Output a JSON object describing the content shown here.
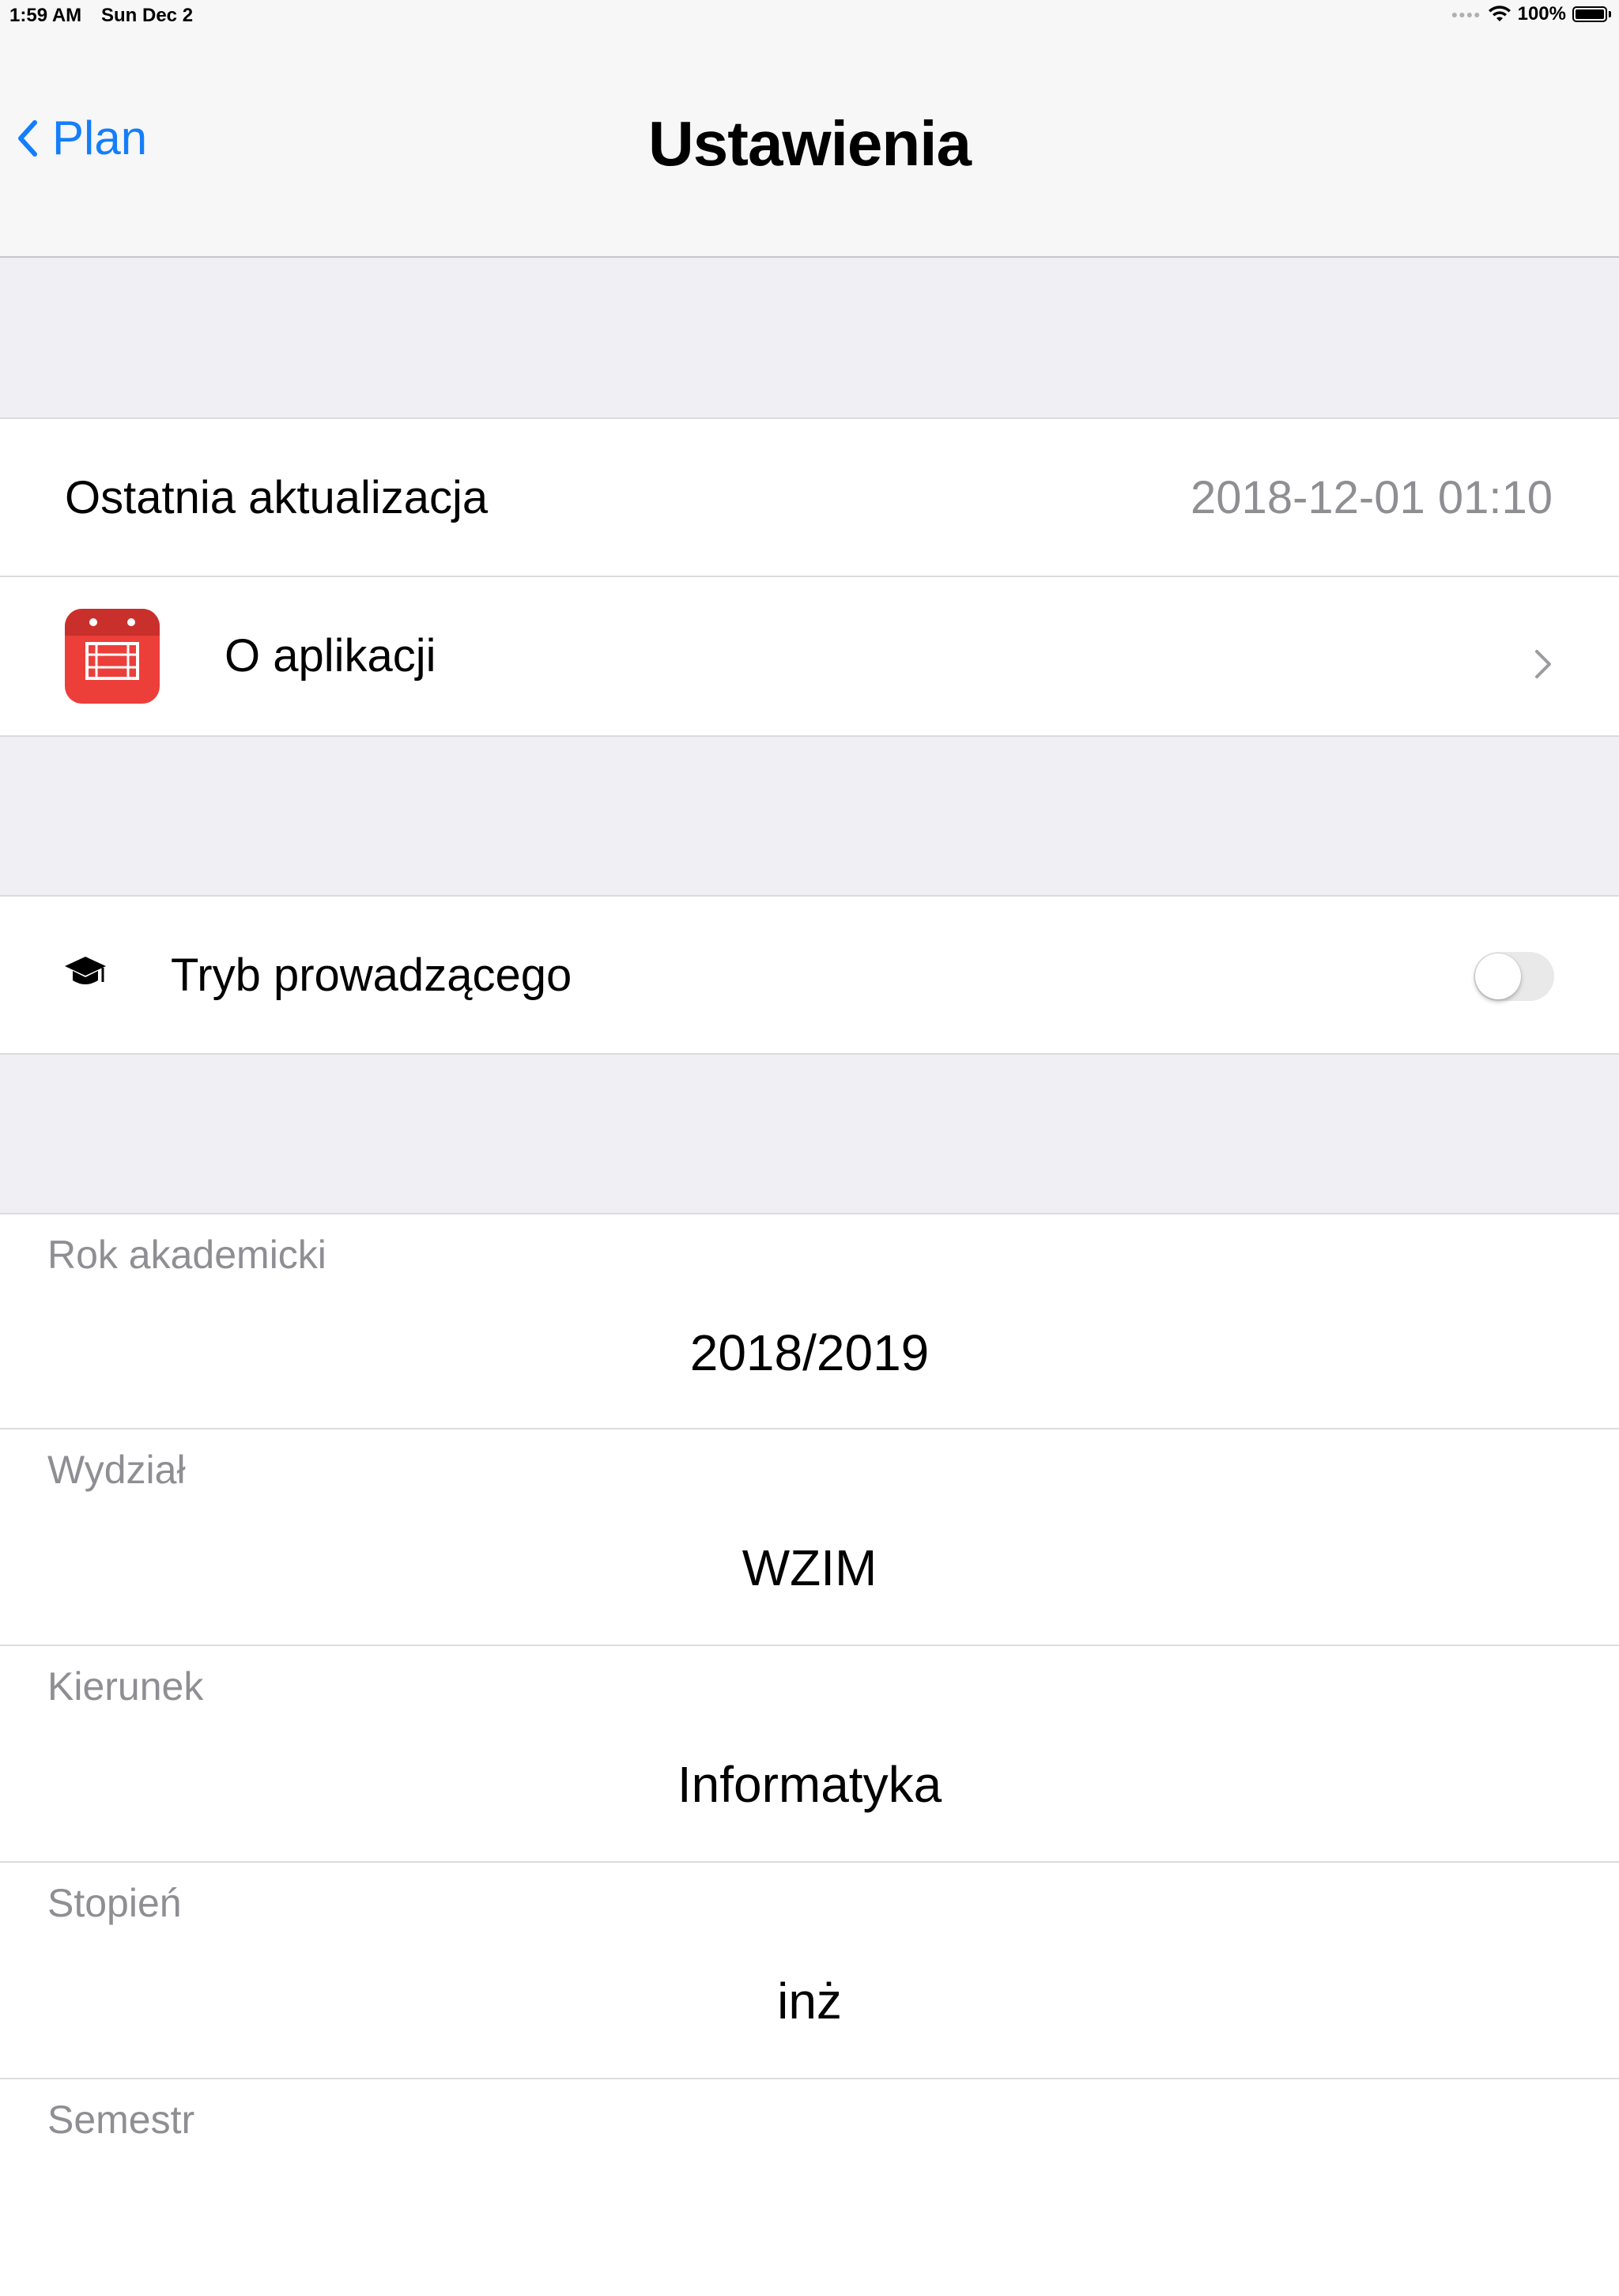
{
  "status_bar": {
    "time": "1:59 AM",
    "date": "Sun Dec 2",
    "battery": "100%",
    "icons": [
      "signal-dots-icon",
      "wifi-icon",
      "battery-icon"
    ]
  },
  "nav": {
    "back_label": "Plan",
    "title": "Ustawienia"
  },
  "colors": {
    "accent": "#147efb",
    "app_icon_red": "#ec3f3a",
    "secondary_text": "#8e8e93",
    "background": "#efeff4"
  },
  "last_update": {
    "label": "Ostatnia aktualizacja",
    "value": "2018-12-01 01:10"
  },
  "about": {
    "label": "O aplikacji",
    "icon": "calendar-app-icon"
  },
  "lecturer_mode": {
    "label": "Tryb prowadzącego",
    "icon": "graduation-cap-icon",
    "enabled": false
  },
  "pickers": [
    {
      "caption": "Rok akademicki",
      "value": "2018/2019"
    },
    {
      "caption": "Wydział",
      "value": "WZIM"
    },
    {
      "caption": "Kierunek",
      "value": "Informatyka"
    },
    {
      "caption": "Stopień",
      "value": "inż"
    },
    {
      "caption": "Semestr",
      "value": ""
    }
  ]
}
